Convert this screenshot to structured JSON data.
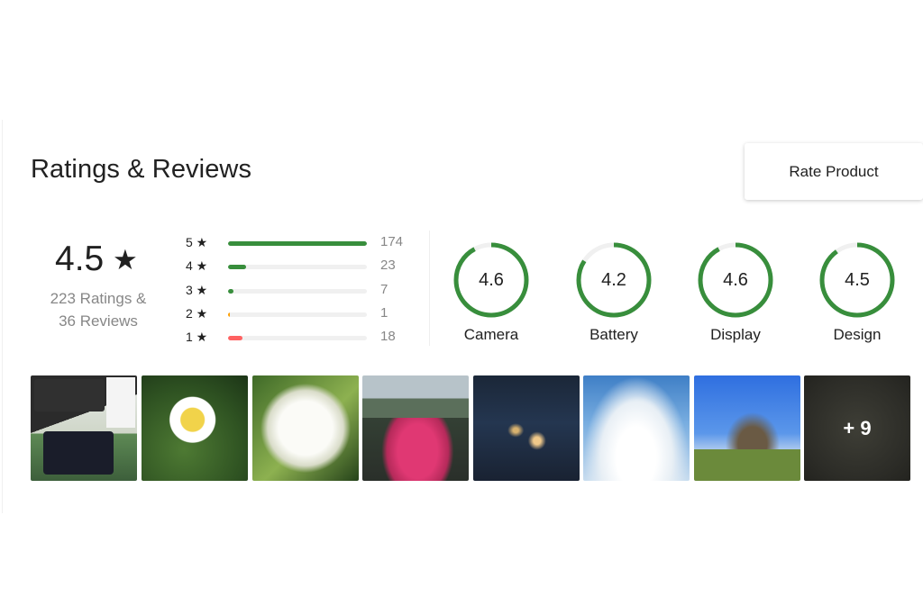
{
  "section": {
    "title": "Ratings & Reviews"
  },
  "rate_button": {
    "label": "Rate Product"
  },
  "summary": {
    "average": "4.5",
    "star": "★",
    "ratings_text": "223 Ratings &",
    "reviews_text": "36 Reviews"
  },
  "distribution": [
    {
      "label": "5 ★",
      "count": "174",
      "fraction": 1.0,
      "color": "#388e3c"
    },
    {
      "label": "4 ★",
      "count": "23",
      "fraction": 0.132,
      "color": "#388e3c"
    },
    {
      "label": "3 ★",
      "count": "7",
      "fraction": 0.04,
      "color": "#388e3c"
    },
    {
      "label": "2 ★",
      "count": "1",
      "fraction": 0.006,
      "color": "#ff9f00"
    },
    {
      "label": "1 ★",
      "count": "18",
      "fraction": 0.103,
      "color": "#ff6161"
    }
  ],
  "aspects": [
    {
      "name": "Camera",
      "value": "4.6",
      "max": 5
    },
    {
      "name": "Battery",
      "value": "4.2",
      "max": 5
    },
    {
      "name": "Display",
      "value": "4.6",
      "max": 5
    },
    {
      "name": "Design",
      "value": "4.5",
      "max": 5
    }
  ],
  "gauge_colors": {
    "fill": "#388e3c",
    "track": "#f0f0f0"
  },
  "photos": {
    "more_label": "+ 9"
  }
}
